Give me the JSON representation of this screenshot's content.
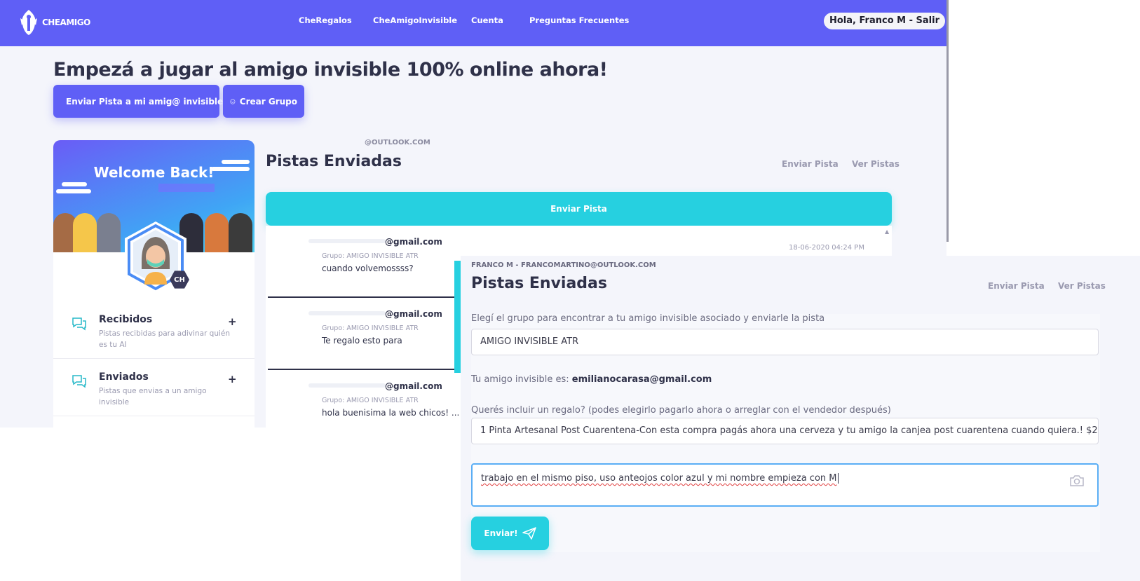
{
  "brand": {
    "logo_text": "CHEAMIGO"
  },
  "nav": {
    "links": [
      "CheRegalos",
      "CheAmigoInvisible",
      "Cuenta",
      "Preguntas Frecuentes"
    ],
    "user_greeting": "Hola, Franco M - Salir"
  },
  "hero": {
    "title": "Empezá a jugar al amigo invisible 100% online ahora!",
    "send_clue_button": "Enviar Pista a mi amig@ invisible",
    "create_group_button": "Crear Grupo"
  },
  "profile": {
    "welcome": "Welcome Back!",
    "badge": "CH",
    "menu": [
      {
        "title": "Recibidos",
        "desc": "Pistas recibidas para adivinar quién es tu AI",
        "toggle": "+"
      },
      {
        "title": "Enviados",
        "desc": "Pistas que envias a un amigo invisible",
        "toggle": "+"
      }
    ]
  },
  "background_panel": {
    "email": "@OUTLOOK.COM",
    "title": "Pistas Enviadas",
    "tab_send": "Enviar Pista",
    "tab_view": "Ver Pistas",
    "send_bar": "Enviar Pista",
    "date": "18-06-2020 04:24 PM",
    "clues": [
      {
        "email": "@gmail.com",
        "group": "Grupo: AMIGO INVISIBLE ATR",
        "text": "cuando volvemossss?"
      },
      {
        "email": "@gmail.com",
        "group": "Grupo: AMIGO INVISIBLE ATR",
        "text": "Te regalo esto para"
      },
      {
        "email": "@gmail.com",
        "group": "Grupo: AMIGO INVISIBLE ATR",
        "text": "hola buenisima la web chicos! ..."
      }
    ]
  },
  "form": {
    "user_email": "FRANCO M - FRANCOMARTINO@OUTLOOK.COM",
    "title": "Pistas Enviadas",
    "tab_send": "Enviar Pista",
    "tab_view": "Ver Pistas",
    "group_label": "Elegí el grupo para encontrar a tu amigo invisible asociado y enviarle la pista",
    "group_value": "AMIGO INVISIBLE ATR",
    "friend_prefix": "Tu amigo invisible es:",
    "friend_email": "emilianocarasa@gmail.com",
    "gift_label": "Querés incluir un regalo? (podes elegirlo pagarlo ahora o arreglar con el vendedor después)",
    "gift_value": "1 Pinta Artesanal Post Cuarentena-Con esta compra pagás ahora una cerveza y tu amigo la canjea post cuarentena cuando quiera.! $2",
    "clue_value": "trabajo en el mismo piso, uso anteojos color azul y mi nombre empieza con M",
    "submit": "Enviar!"
  },
  "colors": {
    "primary": "#5f5ff6",
    "accent": "#26d0e0",
    "text": "#2f3149",
    "muted": "#9a9ab0"
  },
  "icons": [
    "logo-icon",
    "plus-icon",
    "smiley-icon",
    "chat-icon",
    "camera-icon",
    "send-icon"
  ]
}
